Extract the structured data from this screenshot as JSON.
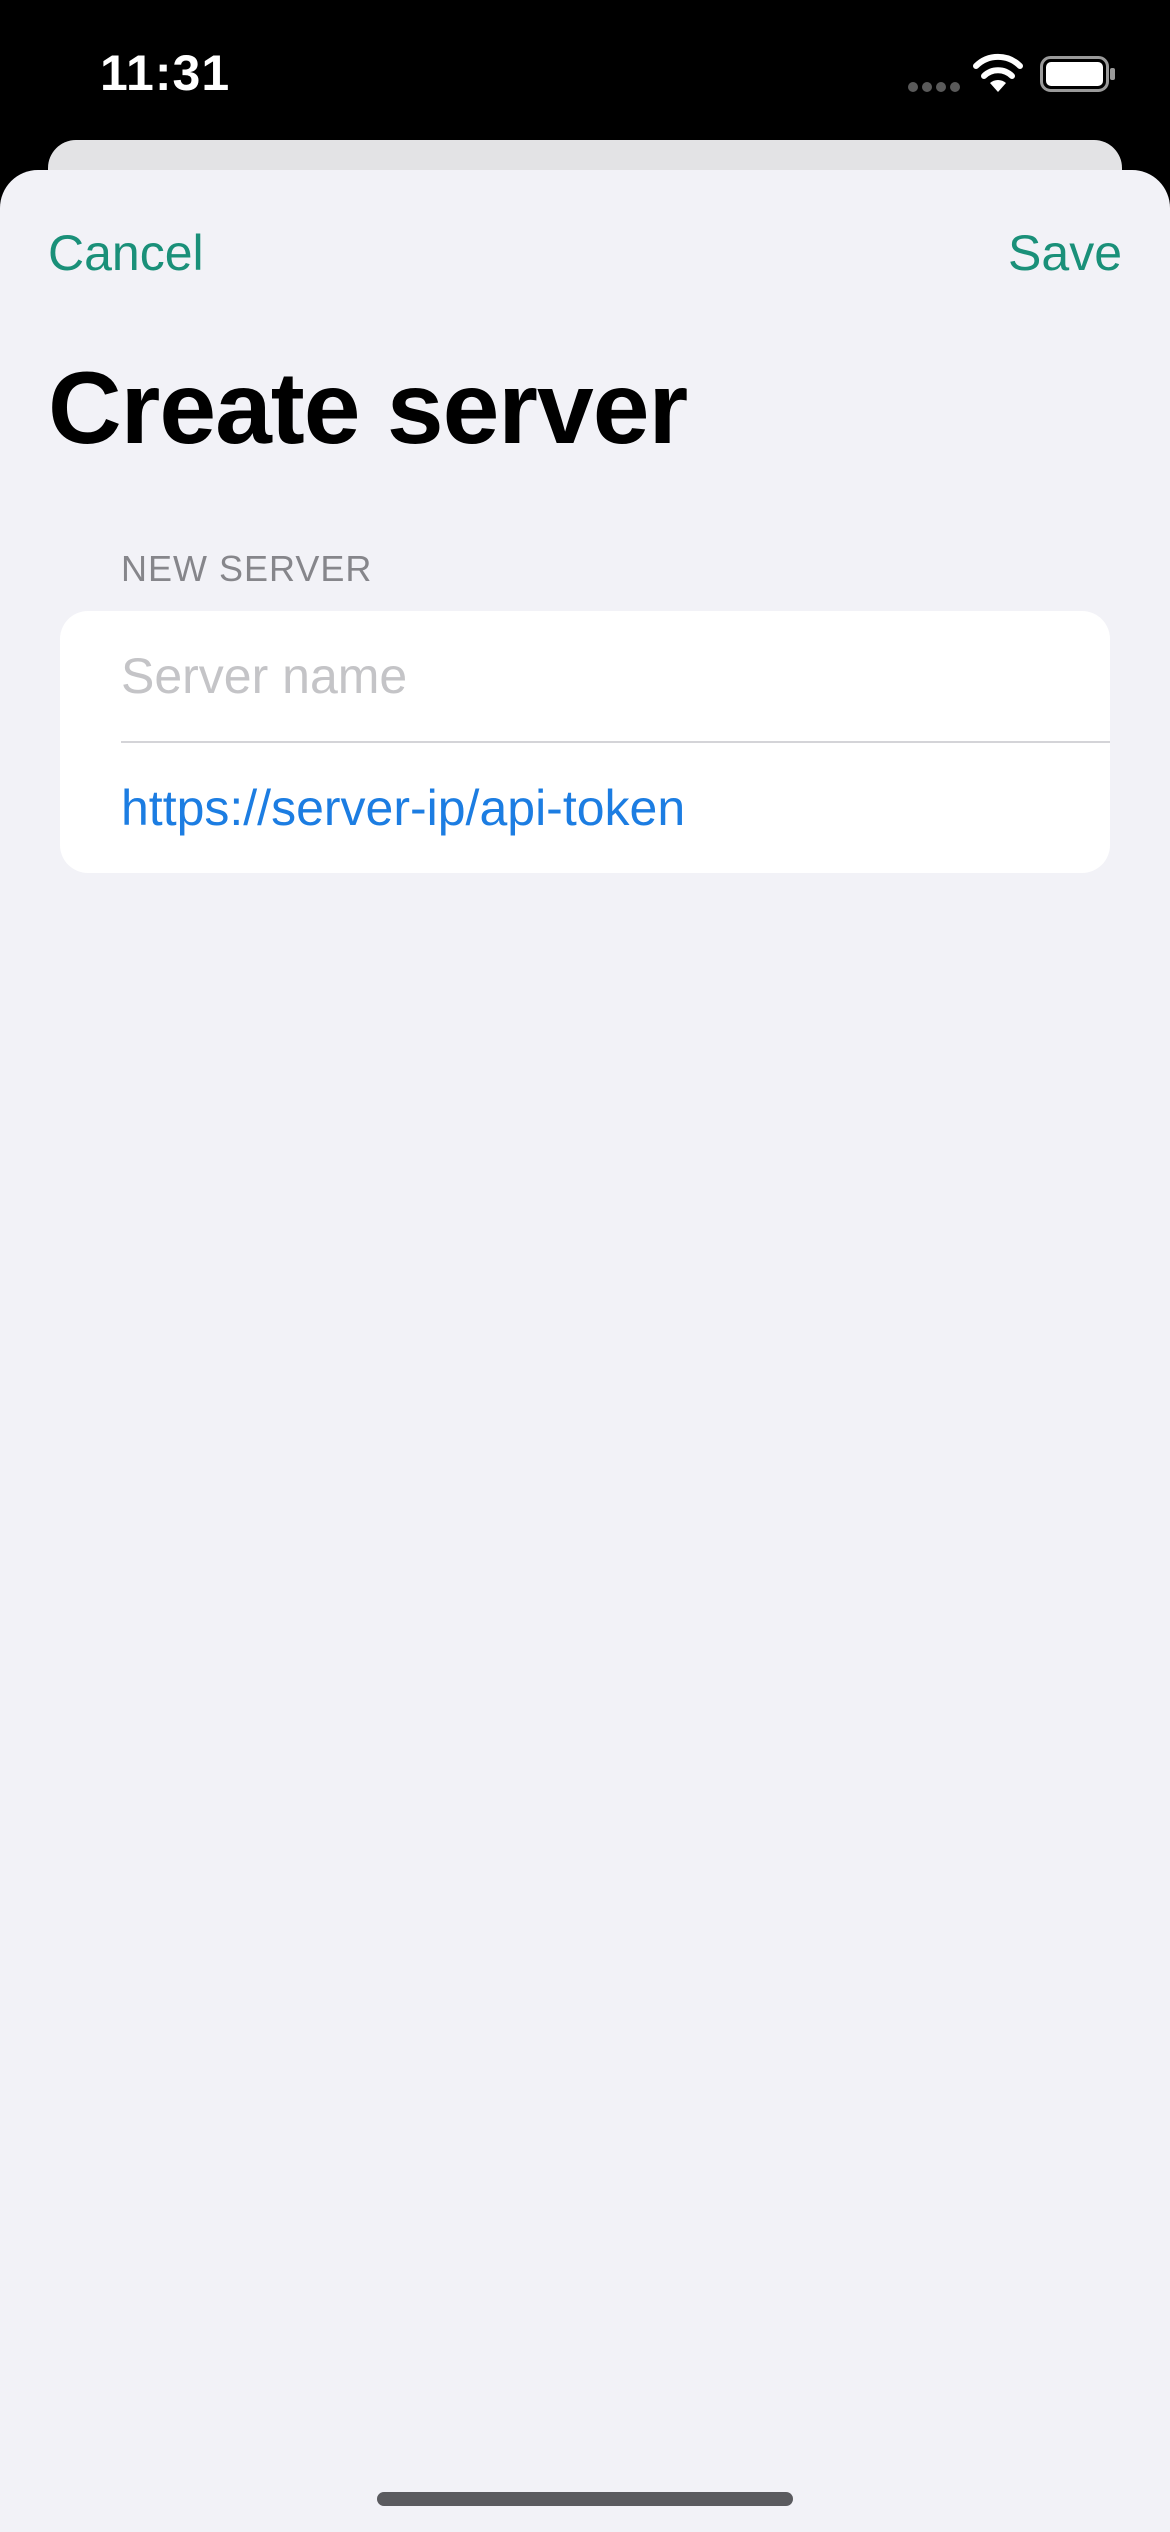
{
  "status_bar": {
    "time": "11:31",
    "icons": [
      "cellular-signal-icon",
      "wifi-icon",
      "battery-icon"
    ]
  },
  "nav": {
    "cancel_label": "Cancel",
    "save_label": "Save"
  },
  "title": "Create server",
  "form": {
    "section_header": "NEW SERVER",
    "server_name": {
      "value": "",
      "placeholder": "Server name"
    },
    "server_url": {
      "value": "",
      "placeholder": "https://server-ip/api-token"
    }
  },
  "colors": {
    "accent": "#1a9079",
    "link_blue": "#1c7de2",
    "sheet_background": "#f2f2f7",
    "section_header_gray": "#86868b",
    "placeholder_gray": "#c4c4c7"
  }
}
